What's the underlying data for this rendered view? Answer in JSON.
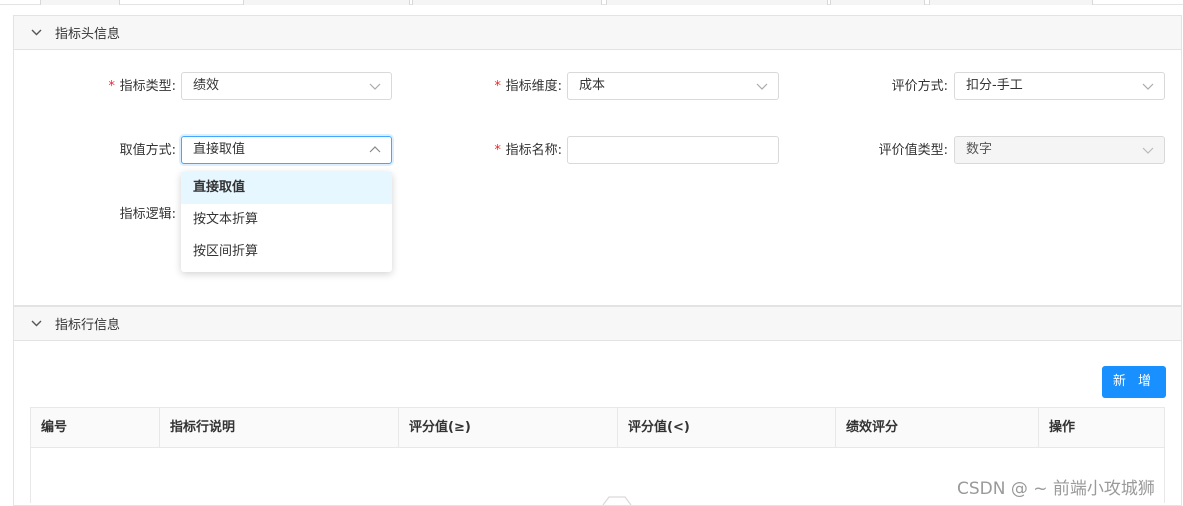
{
  "header_panel": {
    "title": "指标头信息",
    "fields": {
      "indicator_type": {
        "label": "指标类型:",
        "required": true,
        "value": "绩效"
      },
      "indicator_dimension": {
        "label": "指标维度:",
        "required": true,
        "value": "成本"
      },
      "evaluation_method": {
        "label": "评价方式:",
        "required": false,
        "value": "扣分-手工"
      },
      "value_method": {
        "label": "取值方式:",
        "required": false,
        "value": "直接取值"
      },
      "indicator_name": {
        "label": "指标名称:",
        "required": true,
        "value": ""
      },
      "evaluation_value_type": {
        "label": "评价值类型:",
        "required": false,
        "value": "数字"
      },
      "indicator_logic": {
        "label": "指标逻辑:",
        "required": false
      }
    },
    "required_mark": "*",
    "dropdown_options": [
      "直接取值",
      "按文本折算",
      "按区间折算"
    ]
  },
  "rows_panel": {
    "title": "指标行信息",
    "add_button": "新 增",
    "columns": [
      "编号",
      "指标行说明",
      "评分值(≥)",
      "评分值(<)",
      "绩效评分",
      "操作"
    ]
  },
  "watermark": "CSDN @ ~ 前端小攻城狮",
  "colors": {
    "primary": "#1890ff",
    "required": "#f5222d",
    "active_option_bg": "#e6f7ff"
  },
  "icons": {
    "collapse": "chevron-down-icon",
    "select_arrow": "chevron-down-icon",
    "open_select_arrow": "chevron-up-icon"
  }
}
